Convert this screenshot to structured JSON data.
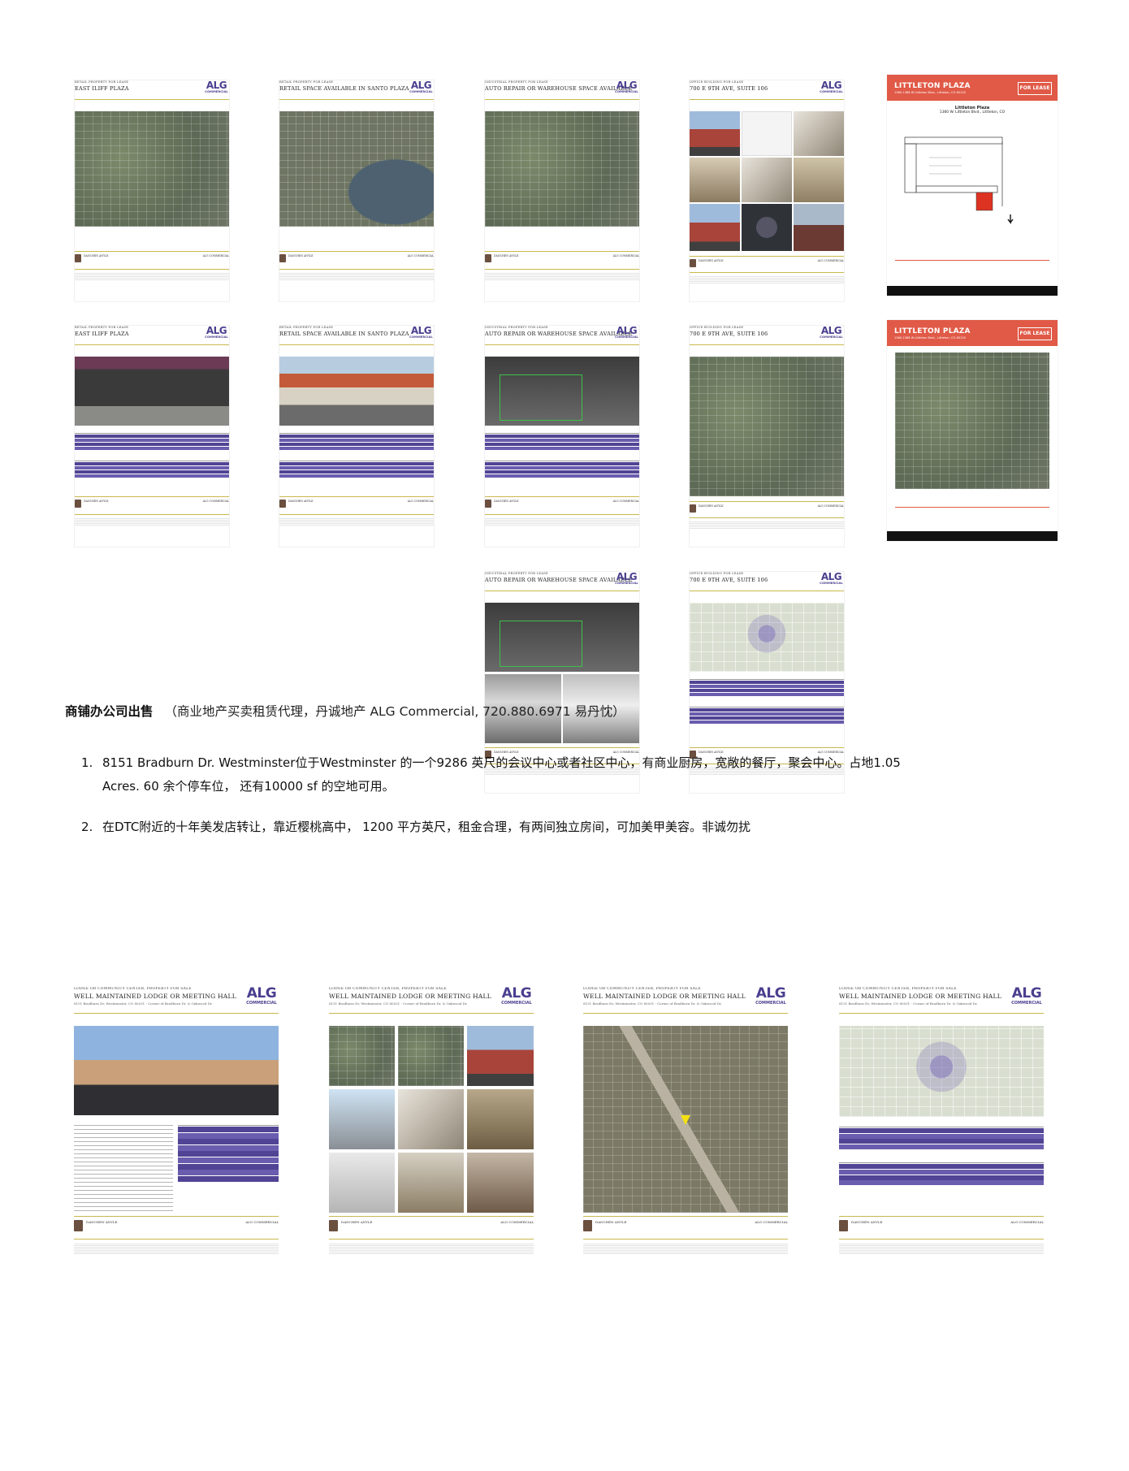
{
  "flyers_row1": [
    {
      "category": "RETAIL PROPERTY FOR LEASE",
      "title": "EAST ILIFF PLAZA"
    },
    {
      "category": "RETAIL PROPERTY FOR LEASE",
      "title": "RETAIL SPACE AVAILABLE IN SANTO PLAZA"
    },
    {
      "category": "INDUSTRIAL PROPERTY FOR LEASE",
      "title": "AUTO REPAIR OR WAREHOUSE SPACE AVAILABLE"
    },
    {
      "category": "OFFICE BUILDING FOR LEASE",
      "title": "700 E 9TH AVE, SUITE 106"
    }
  ],
  "flyers_row2": [
    {
      "category": "RETAIL PROPERTY FOR LEASE",
      "title": "EAST ILIFF PLAZA"
    },
    {
      "category": "RETAIL PROPERTY FOR LEASE",
      "title": "RETAIL SPACE AVAILABLE IN SANTO PLAZA"
    },
    {
      "category": "INDUSTRIAL PROPERTY FOR LEASE",
      "title": "AUTO REPAIR OR WAREHOUSE SPACE AVAILABLE"
    },
    {
      "category": "OFFICE BUILDING FOR LEASE",
      "title": "700 E 9TH AVE, SUITE 106"
    }
  ],
  "flyers_row3": [
    {
      "category": "INDUSTRIAL PROPERTY FOR LEASE",
      "title": "AUTO REPAIR OR WAREHOUSE SPACE AVAILABLE"
    },
    {
      "category": "OFFICE BUILDING FOR LEASE",
      "title": "700 E 9TH AVE, SUITE 106"
    }
  ],
  "flyers_row4": [
    {
      "category": "LODGE OR COMMUNITY CENTER, PROPERTY FOR SALE",
      "title": "WELL MAINTAINED LODGE OR MEETING HALL",
      "address": "8151 Bradburn Dr, Westminster, CO 80031 - Corner of Bradburn Dr. & Oakwood Dr."
    },
    {
      "category": "LODGE OR COMMUNITY CENTER, PROPERTY FOR SALE",
      "title": "WELL MAINTAINED LODGE OR MEETING HALL",
      "address": "8151 Bradburn Dr, Westminster, CO 80031 - Corner of Bradburn Dr. & Oakwood Dr."
    },
    {
      "category": "LODGE OR COMMUNITY CENTER, PROPERTY FOR SALE",
      "title": "WELL MAINTAINED LODGE OR MEETING HALL",
      "address": "8151 Bradburn Dr, Westminster, CO 80031 - Corner of Bradburn Dr. & Oakwood Dr."
    },
    {
      "category": "LODGE OR COMMUNITY CENTER, PROPERTY FOR SALE",
      "title": "WELL MAINTAINED LODGE OR MEETING HALL",
      "address": "8151 Bradburn Dr, Westminster, CO 80031 - Corner of Bradburn Dr. & Oakwood Dr."
    }
  ],
  "logo": {
    "main": "ALG",
    "sub": "COMMERCIAL"
  },
  "agent": {
    "name": "DANCHEN ANYLE",
    "brand": "ALG COMMERCIAL"
  },
  "littleton": {
    "title": "LITTLETON PLAZA",
    "subtitle": "1360-1368 W Littleton Blvd., Littleton, CO 80120",
    "badge": "FOR LEASE",
    "plan_title": "Littleton Plaza",
    "plan_address": "1360 W. Littleton Blvd., Littleton, CO"
  },
  "heading": {
    "bold": "商铺办公司出售",
    "paren": "（商业地产买卖租赁代理，丹诚地产 ALG Commercial, 720.880.6971 易丹忱）"
  },
  "items": [
    {
      "num": "1.",
      "text": "8151 Bradburn Dr. Westminster位于Westminster 的一个9286 英尺的会议中心或者社区中心，有商业厨房，宽敞的餐厅，聚会中心。占地1.05 Acres. 60 余个停车位， 还有10000 sf 的空地可用。"
    },
    {
      "num": "2.",
      "text": "在DTC附近的十年美发店转让，靠近樱桃高中， 1200 平方英尺，租金合理，有两间独立房间，可加美甲美容。非诚勿扰"
    }
  ],
  "colors": {
    "purple": "#514494",
    "gold": "#c9b84c",
    "littleton_red": "#e05a47"
  }
}
